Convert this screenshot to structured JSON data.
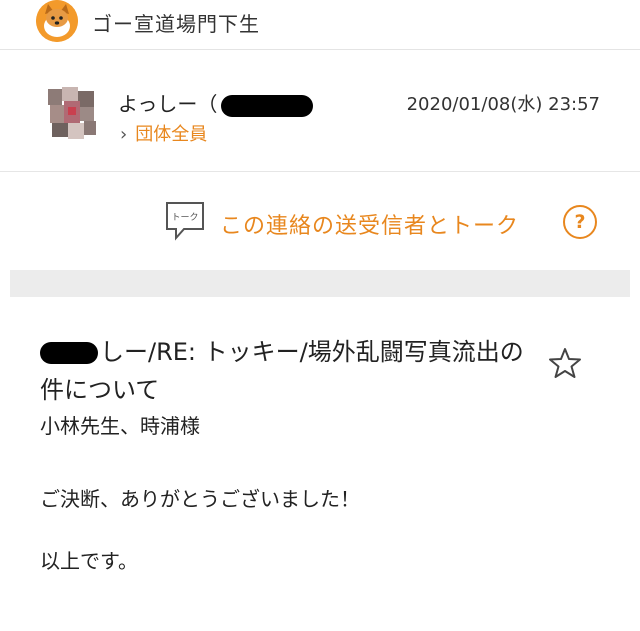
{
  "header": {
    "group_name": "ゴー宣道場門下生",
    "group_avatar_icon": "shiba-dog-icon"
  },
  "message_meta": {
    "sender_visible": "よっしー（",
    "datetime": "2020/01/08(水) 23:57",
    "recipient_chevron": "›",
    "recipient_label": "団体全員"
  },
  "talk": {
    "icon_name": "talk-bubble-icon",
    "icon_label": "トーク",
    "link_label": "この連絡の送受信者とトーク",
    "help_label": "?"
  },
  "message": {
    "subject_visible": "しー/RE: トッキー/場外乱闘写真流出の件について",
    "body_lines": [
      "小林先生、時浦様",
      "ご決断、ありがとうございました！",
      "以上です。"
    ],
    "star_icon": "star-outline-icon"
  },
  "colors": {
    "accent": "#e8871e",
    "band": "#ececec",
    "avatar": "#f39a2b"
  }
}
